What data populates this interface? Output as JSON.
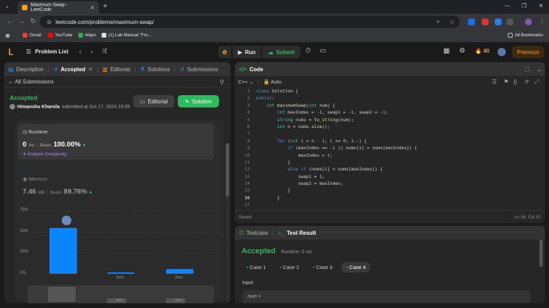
{
  "browser": {
    "tab_title": "Maximum Swap - LeetCode",
    "url": "leetcode.com/problems/maximum-swap/",
    "bookmarks": [
      "Gmail",
      "YouTube",
      "Maps",
      "(1) Lab Manual \"Fro..."
    ],
    "all_bookmarks": "All Bookmarks"
  },
  "topbar": {
    "problem_list": "Problem List",
    "run": "Run",
    "submit": "Submit",
    "streak": "40",
    "premium": "Premium"
  },
  "left": {
    "tabs": [
      "Description",
      "Accepted",
      "Editorial",
      "Solutions",
      "Submissions"
    ],
    "all_submissions": "All Submissions",
    "status": "Accepted",
    "user": "Himanshu Kharola",
    "submitted": "submitted at Oct 17, 2024 23:05",
    "editorial_btn": "Editorial",
    "solution_btn": "Solution",
    "runtime_label": "Runtime",
    "runtime_value": "0",
    "runtime_unit": "ms",
    "runtime_beats_label": "Beats",
    "runtime_beats": "100.00%",
    "analyze": "Analyze Complexity",
    "memory_label": "Memory",
    "memory_value": "7.46",
    "memory_unit": "MB",
    "memory_beats_label": "Beats",
    "memory_beats": "89.76%"
  },
  "chart_data": {
    "type": "bar",
    "yticks": [
      "75%",
      "50%",
      "25%",
      "0%"
    ],
    "categories": [
      "0ms",
      "1ms",
      "2ms"
    ],
    "x_labels_shown": [
      "",
      "1ms",
      "2ms"
    ],
    "values": [
      55,
      2,
      6
    ],
    "ylim": [
      0,
      75
    ],
    "mini_labels": [
      "1ms",
      "2ms"
    ],
    "bar_color": "#0a84ff"
  },
  "code": {
    "title": "Code",
    "language": "C++",
    "mode": "Auto",
    "saved": "Saved",
    "cursor": "Ln 16, Col 10",
    "lines": [
      "class Solution {",
      "public:",
      "    int maximumSwap(int num) {",
      "        int maxIndex = -1, swap1 = -1, swap2 = -1;",
      "        string nums = to_string(num);",
      "        int n = nums.size();",
      "",
      "        for (int i = n - 1; i >= 0; i--) {",
      "            if (maxIndex == -1 || nums[i] > nums[maxIndex]) {",
      "                maxIndex = i;",
      "            }",
      "            else if (nums[i] < nums[maxIndex]) {",
      "                swap1 = i;",
      "                swap2 = maxIndex;",
      "            }",
      "        }",
      ""
    ]
  },
  "tests": {
    "testcase_tab": "Testcase",
    "result_tab": "Test Result",
    "status": "Accepted",
    "runtime": "Runtime: 0 ms",
    "cases": [
      "Case 1",
      "Case 2",
      "Case 3",
      "Case 4"
    ],
    "input_label": "Input",
    "input_value": "num ="
  }
}
